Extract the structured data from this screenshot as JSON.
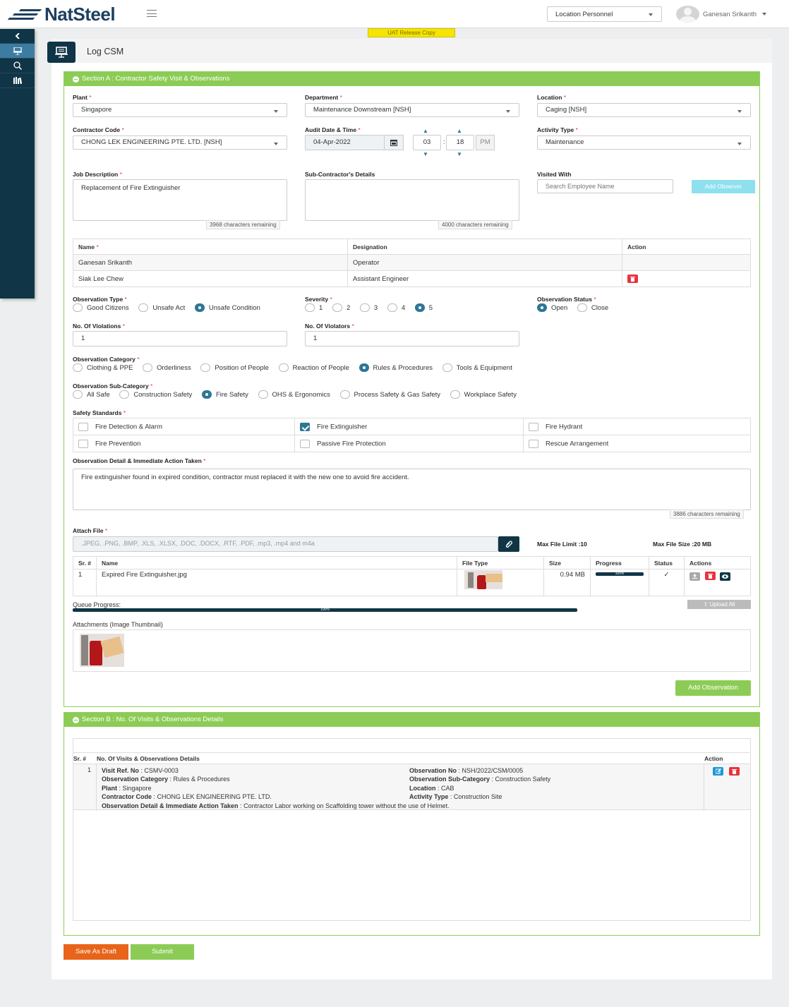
{
  "header": {
    "logo_text": "NatSteel",
    "role_select": "Location Personnel",
    "user_name": "Ganesan Srikanth",
    "uat_banner": "UAT Release Copy"
  },
  "page": {
    "title": "Log CSM"
  },
  "section_a": {
    "title": "Section A : Contractor Safety Visit & Observations",
    "plant": {
      "label": "Plant",
      "value": "Singapore"
    },
    "department": {
      "label": "Department",
      "value": "Maintenance Downstream [NSH]"
    },
    "location": {
      "label": "Location",
      "value": "Caging [NSH]"
    },
    "contractor_code": {
      "label": "Contractor Code",
      "value": "CHONG LEK ENGINEERING PTE. LTD. [NSH]"
    },
    "audit_date": {
      "label": "Audit Date & Time",
      "date": "04-Apr-2022",
      "hour": "03",
      "minute": "18",
      "ampm": "PM"
    },
    "activity_type": {
      "label": "Activity Type",
      "value": "Maintenance"
    },
    "job_description": {
      "label": "Job Description",
      "value": "Replacement of Fire Extinguisher",
      "remaining": "3968 characters remaining"
    },
    "sub_contractor": {
      "label": "Sub-Contractor's Details",
      "value": "",
      "remaining": "4000 characters remaining"
    },
    "visited_with": {
      "label": "Visited With",
      "placeholder": "Search Employee Name",
      "add_button": "Add Observer"
    },
    "observer_table": {
      "headers": {
        "name": "Name",
        "designation": "Designation",
        "action": "Action"
      },
      "rows": [
        {
          "name": "Ganesan Srikanth",
          "designation": "Operator"
        },
        {
          "name": "Siak Lee Chew",
          "designation": "Assistant Engineer"
        }
      ]
    },
    "observation_type": {
      "label": "Observation Type",
      "options": [
        "Good Citizens",
        "Unsafe Act",
        "Unsafe Condition"
      ],
      "selected": "Unsafe Condition"
    },
    "severity": {
      "label": "Severity",
      "options": [
        "1",
        "2",
        "3",
        "4",
        "5"
      ],
      "selected": "5"
    },
    "observation_status": {
      "label": "Observation Status",
      "options": [
        "Open",
        "Close"
      ],
      "selected": "Open"
    },
    "violations": {
      "label": "No. Of Violations",
      "value": "1"
    },
    "violators": {
      "label": "No. Of Violators",
      "value": "1"
    },
    "observation_category": {
      "label": "Observation Category",
      "options": [
        "Clothing & PPE",
        "Orderliness",
        "Position of People",
        "Reaction of People",
        "Rules & Procedures",
        "Tools & Equipment"
      ],
      "selected": "Rules & Procedures"
    },
    "observation_subcategory": {
      "label": "Observation Sub-Category",
      "options": [
        "All Safe",
        "Construction Safety",
        "Fire Safety",
        "OHS & Ergonomics",
        "Process Safety & Gas Safety",
        "Workplace Safety"
      ],
      "selected": "Fire Safety"
    },
    "safety_standards": {
      "label": "Safety Standards",
      "items": [
        {
          "label": "Fire Detection & Alarm",
          "checked": false
        },
        {
          "label": "Fire Extinguisher",
          "checked": true
        },
        {
          "label": "Fire Hydrant",
          "checked": false
        },
        {
          "label": "Fire Prevention",
          "checked": false
        },
        {
          "label": "Passive Fire Protection",
          "checked": false
        },
        {
          "label": "Rescue Arrangement",
          "checked": false
        }
      ]
    },
    "observation_detail": {
      "label": "Observation Detail & Immediate Action Taken",
      "value": "Fire extinguisher found in expired condition, contractor must replaced it with the new one to avoid fire accident.",
      "remaining": "3886 characters remaining"
    },
    "attach": {
      "label": "Attach File",
      "placeholder": ".JPEG, .PNG, .BMP, .XLS, .XLSX, .DOC, .DOCX, .RTF, .PDF, .mp3, .mp4 and m4a",
      "max_file_limit": "Max File Limit :10",
      "max_file_size": "Max File Size :20 MB",
      "table_headers": {
        "sr": "Sr. #",
        "name": "Name",
        "file_type": "File Type",
        "size": "Size",
        "progress": "Progress",
        "status": "Status",
        "actions": "Actions"
      },
      "files": [
        {
          "sr": "1",
          "name": "Expired Fire Extinguisher.jpg",
          "size": "0.94 MB",
          "progress": "100%",
          "progress_value": 1.0,
          "status": "✓"
        }
      ],
      "queue_label": "Queue Progress:",
      "queue_progress": "100%",
      "queue_value": 1.0,
      "upload_all": "Upload All",
      "thumbs_label": "Attachments (Image Thumbnail)"
    },
    "add_observation": "Add Observation"
  },
  "section_b": {
    "title": "Section B : No. Of Visits & Observations Details",
    "headers": {
      "sr": "Sr. #",
      "details": "No. Of Visits & Observations Details",
      "action": "Action"
    },
    "row": {
      "sr": "1",
      "left": [
        {
          "k": "Visit Ref. No",
          "v": "CSMV-0003"
        },
        {
          "k": "Observation Category",
          "v": "Rules & Procedures"
        },
        {
          "k": "Plant",
          "v": "Singapore"
        },
        {
          "k": "Contractor Code",
          "v": "CHONG LEK ENGINEERING PTE. LTD."
        },
        {
          "k": "Observation Detail & Immediate Action Taken",
          "v": "Contractor Labor working on Scaffolding tower without the use of Helmet."
        }
      ],
      "right": [
        {
          "k": "Observation No",
          "v": "NSH/2022/CSM/0005"
        },
        {
          "k": "Observation Sub-Category",
          "v": "Construction Safety"
        },
        {
          "k": "Location",
          "v": "CAB"
        },
        {
          "k": "Activity Type",
          "v": "Construction Site"
        }
      ]
    }
  },
  "footer": {
    "save_draft": "Save As Draft",
    "submit": "Submit"
  },
  "colors": {
    "navy": "#0f3547",
    "green": "#8ccc56",
    "orange": "#e8641a",
    "red": "#e8333b",
    "radio_on": "#2f7695"
  }
}
